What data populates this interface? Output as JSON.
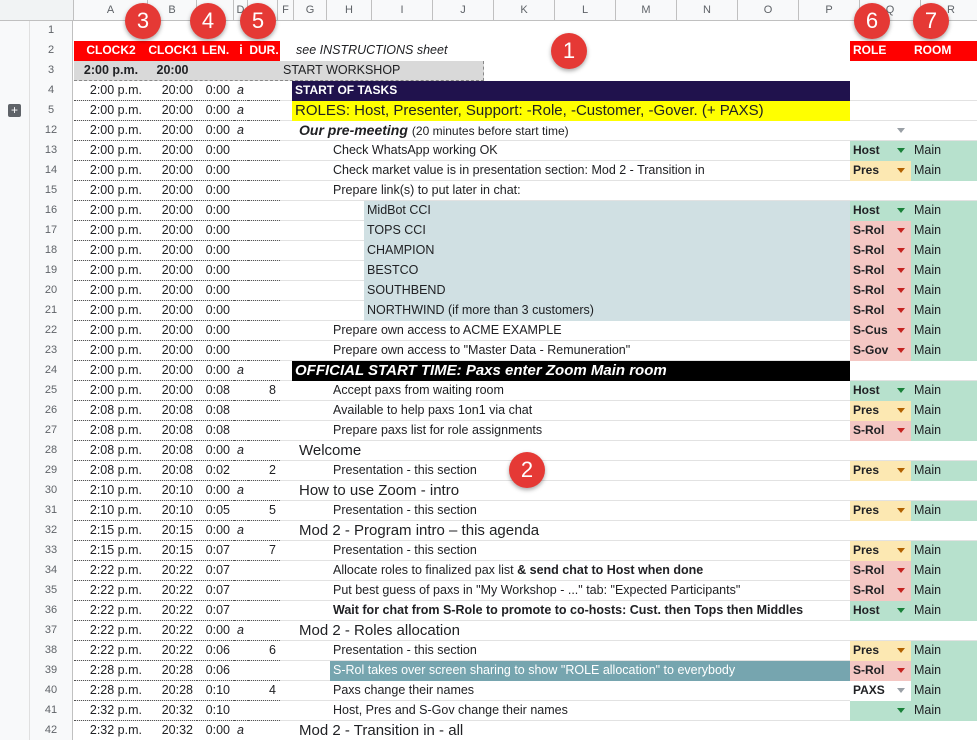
{
  "columns": [
    "A",
    "B",
    "C",
    "D",
    "E",
    "F",
    "G",
    "H",
    "I",
    "J",
    "K",
    "L",
    "M",
    "N",
    "O",
    "P",
    "Q",
    "R"
  ],
  "header_row": {
    "row": "2",
    "clock2": "CLOCK2",
    "clock1": "CLOCK1",
    "len": "LEN.",
    "info": "i",
    "dur": "DUR.",
    "note": "see INSTRUCTIONS sheet",
    "role": "ROLE",
    "room": "ROOM"
  },
  "row1": "1",
  "row3": {
    "row": "3",
    "clock2": "2:00 p.m.",
    "clock1": "20:00",
    "label": "START WORKSHOP"
  },
  "badges": [
    "1",
    "2",
    "3",
    "4",
    "5",
    "6",
    "7"
  ],
  "colors": {
    "red": "#ff0000",
    "navy": "#20124d",
    "yellow": "#ffff00",
    "black": "#000000",
    "role_green": "#b7e1cd",
    "role_yellow": "#fce8b2",
    "role_red": "#f4c7c3",
    "light_blue": "#d0e0e3",
    "teal": "#76a5af",
    "grey": "#d9d9d9"
  },
  "rows": [
    {
      "row": "4",
      "c2": "2:00 p.m.",
      "c1": "20:00",
      "len": "0:00",
      "i": "a",
      "dur": "",
      "indent": 0,
      "text": "START OF TASKS",
      "style": "navy",
      "role": "",
      "room": ""
    },
    {
      "row": "5",
      "c2": "2:00 p.m.",
      "c1": "20:00",
      "len": "0:00",
      "i": "a",
      "dur": "",
      "indent": 0,
      "text": "ROLES: Host, Presenter, Support: -Role, -Customer, -Gover.  (+ PAXS)",
      "style": "yellow",
      "role": "",
      "room": ""
    },
    {
      "row": "12",
      "c2": "2:00 p.m.",
      "c1": "20:00",
      "len": "0:00",
      "i": "a",
      "dur": "",
      "indent": 0,
      "text": "Our pre-meeting",
      "subtext": "(20 minutes before start time)",
      "style": "boldital",
      "role": "",
      "room": "",
      "dropdown": true
    },
    {
      "row": "13",
      "c2": "2:00 p.m.",
      "c1": "20:00",
      "len": "0:00",
      "i": "",
      "dur": "",
      "indent": 1,
      "text": "Check WhatsApp working OK",
      "style": "",
      "role": "Host",
      "roleColor": "green",
      "room": "Main"
    },
    {
      "row": "14",
      "c2": "2:00 p.m.",
      "c1": "20:00",
      "len": "0:00",
      "i": "",
      "dur": "",
      "indent": 1,
      "text": "Check market value is in presentation section: Mod 2 - Transition in",
      "style": "",
      "role": "Pres",
      "roleColor": "yellow",
      "room": "Main"
    },
    {
      "row": "15",
      "c2": "2:00 p.m.",
      "c1": "20:00",
      "len": "0:00",
      "i": "",
      "dur": "",
      "indent": 1,
      "text": "Prepare link(s) to put later in chat:",
      "style": "",
      "role": "",
      "room": ""
    },
    {
      "row": "16",
      "c2": "2:00 p.m.",
      "c1": "20:00",
      "len": "0:00",
      "i": "",
      "dur": "",
      "indent": 2,
      "text": "MidBot CCI",
      "style": "lightblue",
      "role": "Host",
      "roleColor": "green",
      "room": "Main"
    },
    {
      "row": "17",
      "c2": "2:00 p.m.",
      "c1": "20:00",
      "len": "0:00",
      "i": "",
      "dur": "",
      "indent": 2,
      "text": "TOPS CCI",
      "style": "lightblue",
      "role": "S-Rol",
      "roleColor": "red",
      "room": "Main"
    },
    {
      "row": "18",
      "c2": "2:00 p.m.",
      "c1": "20:00",
      "len": "0:00",
      "i": "",
      "dur": "",
      "indent": 2,
      "text": "CHAMPION",
      "style": "lightblue",
      "role": "S-Rol",
      "roleColor": "red",
      "room": "Main"
    },
    {
      "row": "19",
      "c2": "2:00 p.m.",
      "c1": "20:00",
      "len": "0:00",
      "i": "",
      "dur": "",
      "indent": 2,
      "text": "BESTCO",
      "style": "lightblue",
      "role": "S-Rol",
      "roleColor": "red",
      "room": "Main"
    },
    {
      "row": "20",
      "c2": "2:00 p.m.",
      "c1": "20:00",
      "len": "0:00",
      "i": "",
      "dur": "",
      "indent": 2,
      "text": "SOUTHBEND",
      "style": "lightblue",
      "role": "S-Rol",
      "roleColor": "red",
      "room": "Main"
    },
    {
      "row": "21",
      "c2": "2:00 p.m.",
      "c1": "20:00",
      "len": "0:00",
      "i": "",
      "dur": "",
      "indent": 2,
      "text": "NORTHWIND (if more than 3 customers)",
      "style": "lightblue",
      "role": "S-Rol",
      "roleColor": "red",
      "room": "Main"
    },
    {
      "row": "22",
      "c2": "2:00 p.m.",
      "c1": "20:00",
      "len": "0:00",
      "i": "",
      "dur": "",
      "indent": 1,
      "text": "Prepare own access to ACME EXAMPLE",
      "style": "",
      "role": "S-Cus",
      "roleColor": "red",
      "room": "Main"
    },
    {
      "row": "23",
      "c2": "2:00 p.m.",
      "c1": "20:00",
      "len": "0:00",
      "i": "",
      "dur": "",
      "indent": 1,
      "text": "Prepare own access to \"Master Data - Remuneration\"",
      "style": "",
      "role": "S-Gov",
      "roleColor": "red",
      "room": "Main"
    },
    {
      "row": "24",
      "c2": "2:00 p.m.",
      "c1": "20:00",
      "len": "0:00",
      "i": "a",
      "dur": "",
      "indent": 0,
      "text": "OFFICIAL START TIME: Paxs enter Zoom Main room",
      "style": "black",
      "role": "",
      "room": ""
    },
    {
      "row": "25",
      "c2": "2:00 p.m.",
      "c1": "20:00",
      "len": "0:08",
      "i": "",
      "dur": "8",
      "indent": 1,
      "text": "Accept paxs from waiting room",
      "style": "",
      "role": "Host",
      "roleColor": "green",
      "room": "Main"
    },
    {
      "row": "26",
      "c2": "2:08 p.m.",
      "c1": "20:08",
      "len": "0:08",
      "i": "",
      "dur": "",
      "indent": 1,
      "text": "Available to help paxs 1on1 via chat",
      "style": "",
      "role": "Pres",
      "roleColor": "yellow",
      "room": "Main"
    },
    {
      "row": "27",
      "c2": "2:08 p.m.",
      "c1": "20:08",
      "len": "0:08",
      "i": "",
      "dur": "",
      "indent": 1,
      "text": "Prepare paxs list for role assignments",
      "style": "",
      "role": "S-Rol",
      "roleColor": "red",
      "room": "Main"
    },
    {
      "row": "28",
      "c2": "2:08 p.m.",
      "c1": "20:08",
      "len": "0:00",
      "i": "a",
      "dur": "",
      "indent": 0,
      "text": "Welcome",
      "style": "section",
      "role": "",
      "room": ""
    },
    {
      "row": "29",
      "c2": "2:08 p.m.",
      "c1": "20:08",
      "len": "0:02",
      "i": "",
      "dur": "2",
      "indent": 1,
      "text": "Presentation - this section",
      "style": "",
      "role": "Pres",
      "roleColor": "yellow",
      "room": "Main"
    },
    {
      "row": "30",
      "c2": "2:10 p.m.",
      "c1": "20:10",
      "len": "0:00",
      "i": "a",
      "dur": "",
      "indent": 0,
      "text": "How to use Zoom - intro",
      "style": "section",
      "role": "",
      "room": ""
    },
    {
      "row": "31",
      "c2": "2:10 p.m.",
      "c1": "20:10",
      "len": "0:05",
      "i": "",
      "dur": "5",
      "indent": 1,
      "text": "Presentation - this section",
      "style": "",
      "role": "Pres",
      "roleColor": "yellow",
      "room": "Main"
    },
    {
      "row": "32",
      "c2": "2:15 p.m.",
      "c1": "20:15",
      "len": "0:00",
      "i": "a",
      "dur": "",
      "indent": 0,
      "text": "Mod 2 - Program intro – this agenda",
      "style": "section",
      "role": "",
      "room": ""
    },
    {
      "row": "33",
      "c2": "2:15 p.m.",
      "c1": "20:15",
      "len": "0:07",
      "i": "",
      "dur": "7",
      "indent": 1,
      "text": "Presentation - this section",
      "style": "",
      "role": "Pres",
      "roleColor": "yellow",
      "room": "Main"
    },
    {
      "row": "34",
      "c2": "2:22 p.m.",
      "c1": "20:22",
      "len": "0:07",
      "i": "",
      "dur": "",
      "indent": 1,
      "text": "Allocate roles to finalized pax list",
      "boldtail": " & send chat to Host when done",
      "style": "",
      "role": "S-Rol",
      "roleColor": "red",
      "room": "Main"
    },
    {
      "row": "35",
      "c2": "2:22 p.m.",
      "c1": "20:22",
      "len": "0:07",
      "i": "",
      "dur": "",
      "indent": 1,
      "text": "Put best guess of paxs in  \"My Workshop - ...\" tab: \"Expected Participants\"",
      "style": "",
      "role": "S-Rol",
      "roleColor": "red",
      "room": "Main"
    },
    {
      "row": "36",
      "c2": "2:22 p.m.",
      "c1": "20:22",
      "len": "0:07",
      "i": "",
      "dur": "",
      "indent": 1,
      "text": "Wait for chat from S-Role to promote to co-hosts: Cust. then Tops then Middles",
      "style": "bold",
      "role": "Host",
      "roleColor": "green",
      "room": "Main"
    },
    {
      "row": "37",
      "c2": "2:22 p.m.",
      "c1": "20:22",
      "len": "0:00",
      "i": "a",
      "dur": "",
      "indent": 0,
      "text": "Mod 2 - Roles allocation",
      "style": "section",
      "role": "",
      "room": ""
    },
    {
      "row": "38",
      "c2": "2:22 p.m.",
      "c1": "20:22",
      "len": "0:06",
      "i": "",
      "dur": "6",
      "indent": 1,
      "text": "Presentation - this section",
      "style": "",
      "role": "Pres",
      "roleColor": "yellow",
      "room": "Main"
    },
    {
      "row": "39",
      "c2": "2:28 p.m.",
      "c1": "20:28",
      "len": "0:06",
      "i": "",
      "dur": "",
      "indent": 1,
      "text": "S-Rol takes over screen sharing to show \"ROLE allocation\" to everybody",
      "style": "teal",
      "role": "S-Rol",
      "roleColor": "red",
      "room": "Main"
    },
    {
      "row": "40",
      "c2": "2:28 p.m.",
      "c1": "20:28",
      "len": "0:10",
      "i": "",
      "dur": "4",
      "indent": 1,
      "text": "Paxs change their names",
      "style": "",
      "role": "PAXS",
      "roleColor": "white",
      "room": "Main"
    },
    {
      "row": "41",
      "c2": "2:32 p.m.",
      "c1": "20:32",
      "len": "0:10",
      "i": "",
      "dur": "",
      "indent": 1,
      "text": "Host, Pres and S-Gov change their names",
      "style": "",
      "role": "",
      "roleColor": "green",
      "room": "Main",
      "dropdown": true
    },
    {
      "row": "42",
      "c2": "2:32 p.m.",
      "c1": "20:32",
      "len": "0:00",
      "i": "a",
      "dur": "",
      "indent": 0,
      "text": "Mod 2 - Transition in - all",
      "style": "section",
      "role": "",
      "room": ""
    }
  ]
}
